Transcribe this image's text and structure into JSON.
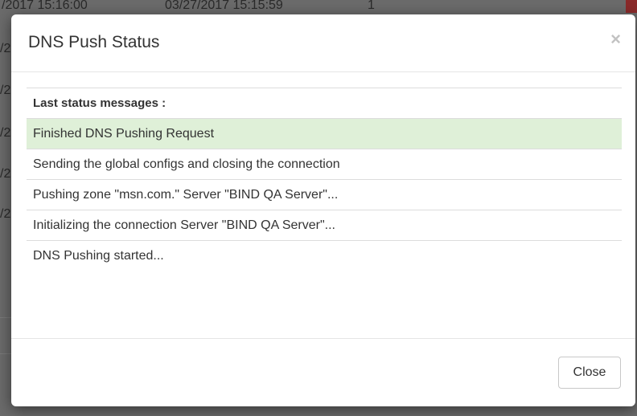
{
  "background": {
    "top_row": {
      "cell1": "/2017 15:16:00",
      "cell2": "03/27/2017 15:15:59",
      "cell3": "1"
    },
    "left_fragments": [
      "/2",
      "/2",
      "/2",
      "/2",
      "/2"
    ]
  },
  "modal": {
    "title": "DNS Push Status",
    "close_icon": "×",
    "table_header": "Last status messages :",
    "messages": [
      {
        "text": "Finished DNS Pushing Request",
        "status": "success"
      },
      {
        "text": "Sending the global configs and closing the connection",
        "status": "normal"
      },
      {
        "text": "Pushing zone \"msn.com.\" Server \"BIND QA Server\"...",
        "status": "normal"
      },
      {
        "text": "Initializing the connection Server \"BIND QA Server\"...",
        "status": "normal"
      },
      {
        "text": "DNS Pushing started...",
        "status": "normal"
      }
    ],
    "close_button_label": "Close"
  },
  "colors": {
    "success_row": "#dff0d8",
    "overlay": "#6b6b6b"
  }
}
